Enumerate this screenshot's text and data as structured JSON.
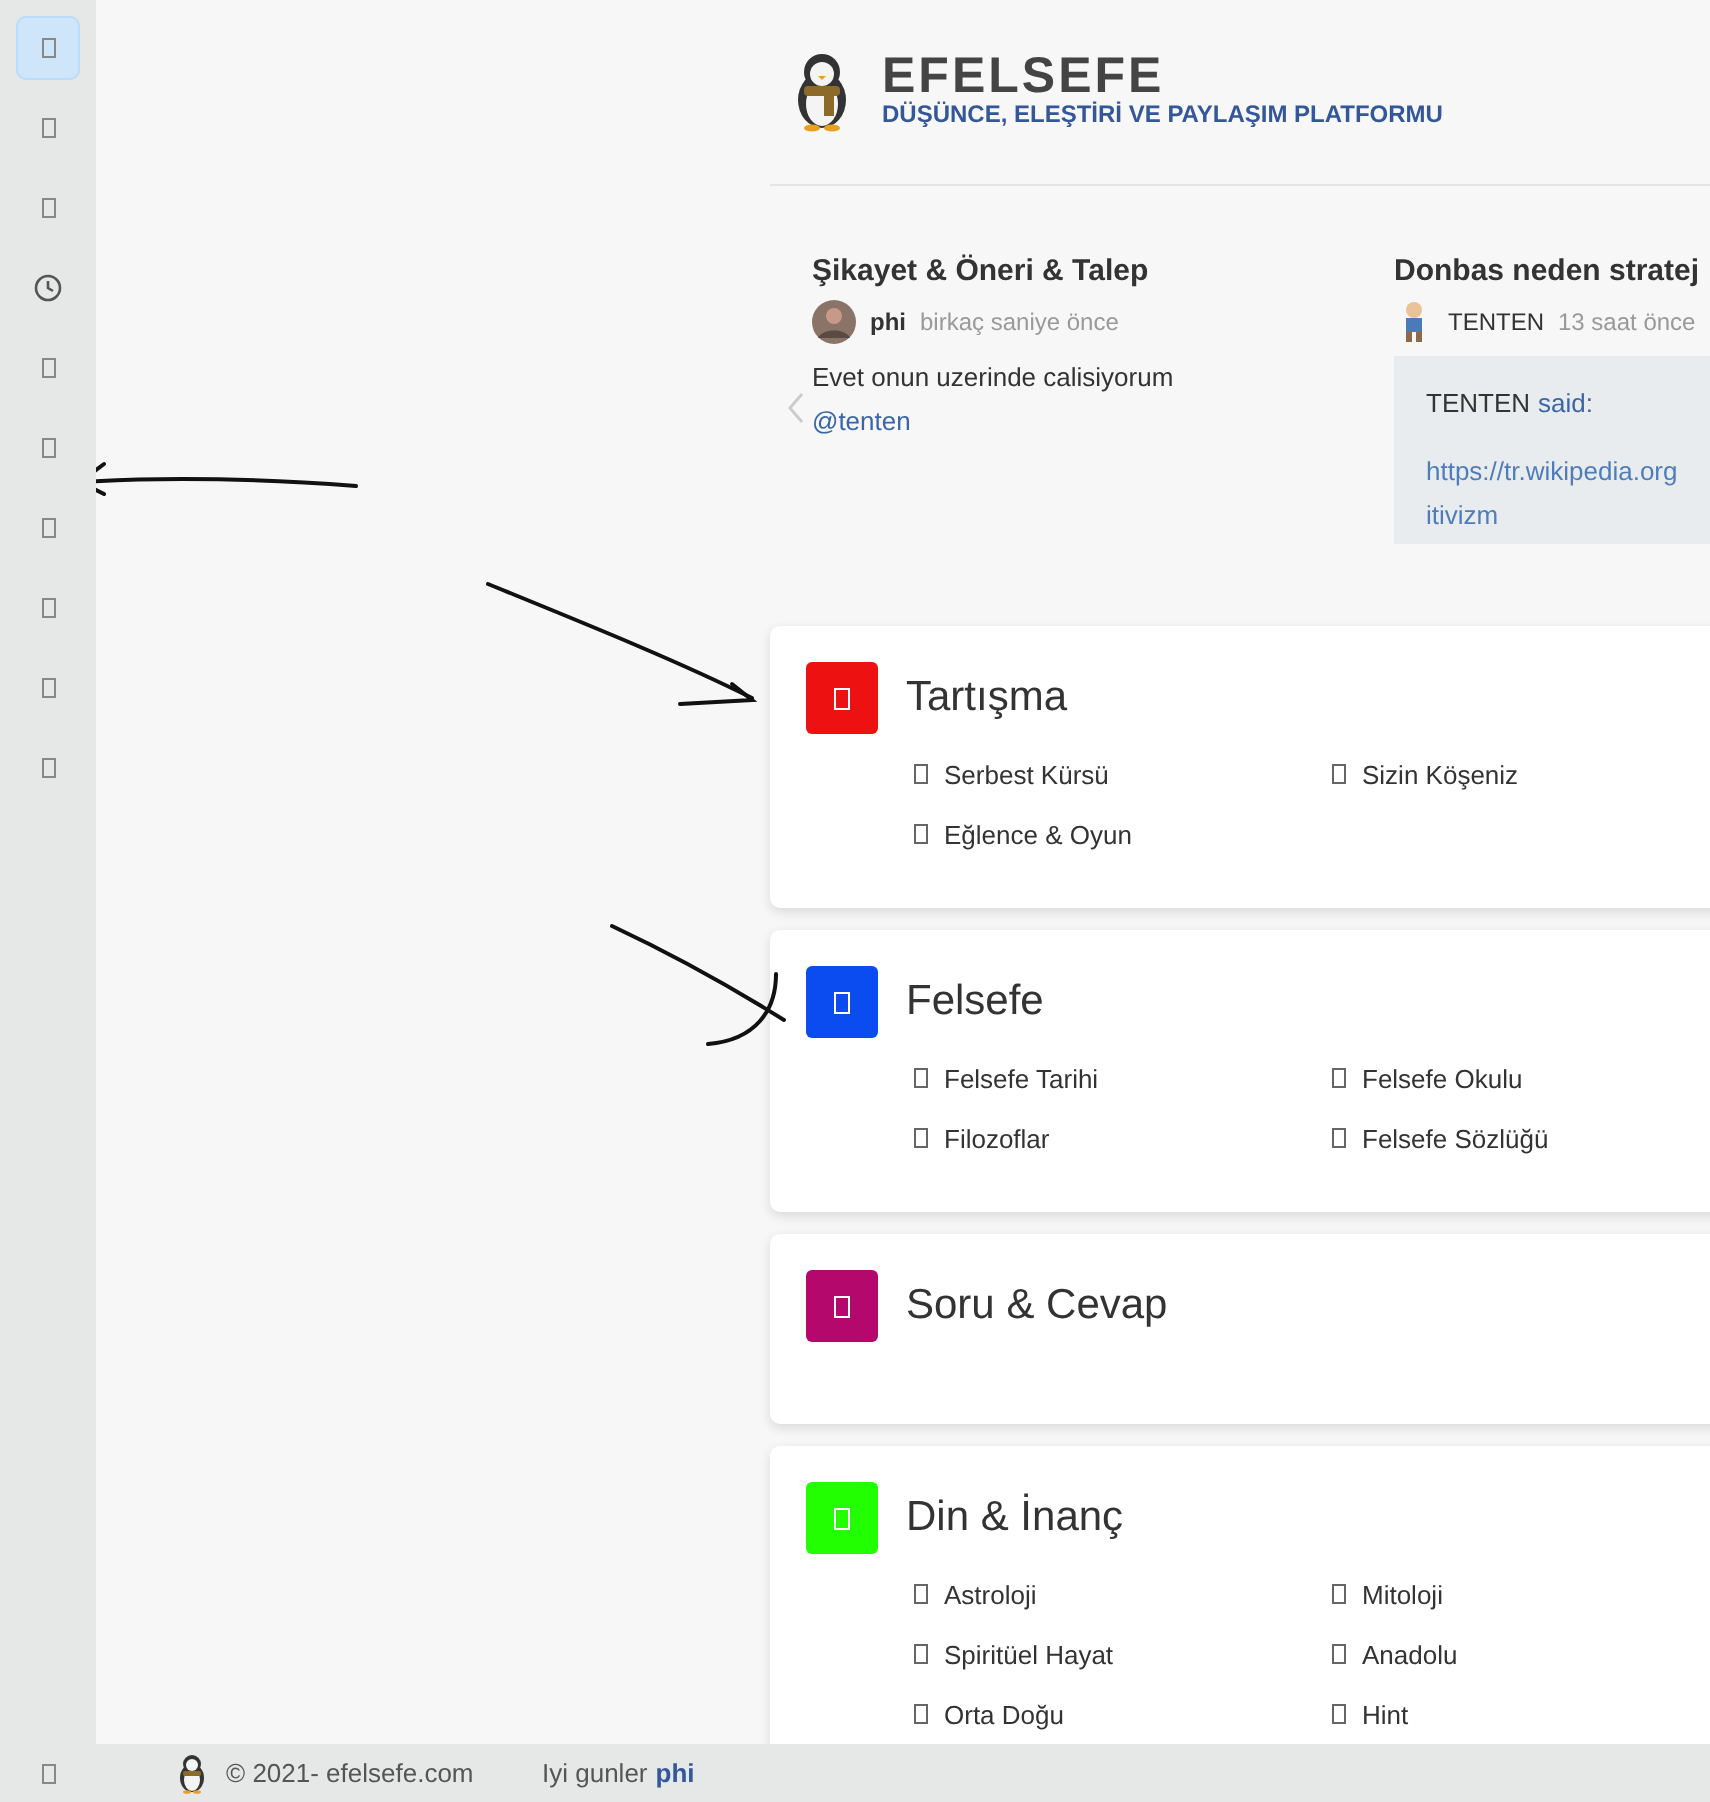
{
  "sidebar": {
    "items": [
      {
        "kind": "glyph",
        "selected": true
      },
      {
        "kind": "glyph",
        "selected": false
      },
      {
        "kind": "glyph",
        "selected": false
      },
      {
        "kind": "clock",
        "selected": false
      },
      {
        "kind": "glyph",
        "selected": false
      },
      {
        "kind": "glyph",
        "selected": false
      },
      {
        "kind": "glyph",
        "selected": false
      },
      {
        "kind": "glyph",
        "selected": false
      },
      {
        "kind": "glyph",
        "selected": false
      },
      {
        "kind": "glyph",
        "selected": false
      }
    ],
    "bottom_item": {
      "kind": "glyph",
      "selected": false
    }
  },
  "header": {
    "title": "EFELSEFE",
    "subtitle": "DÜŞÜNCE, ELEŞTİRİ VE PAYLAŞIM PLATFORMU"
  },
  "recent_posts": [
    {
      "kind": "reply",
      "title": "Şikayet & Öneri & Talep",
      "author": "phi",
      "time": "birkaç saniye önce",
      "body": "Evet onun uzerinde calisiyorum",
      "mention": "@tenten"
    },
    {
      "kind": "quote",
      "title": "Donbas neden stratej",
      "author": "TENTEN",
      "time": "13 saat önce",
      "quote": {
        "author": "TENTEN",
        "said": "said:",
        "link_lines": [
          "https://tr.wikipedia.org",
          "itivizm"
        ]
      }
    }
  ],
  "categories": [
    {
      "title": "Tartışma",
      "color": "#ee1111",
      "forums": [
        "Serbest Kürsü",
        "Sizin Köşeniz",
        "Eğlence & Oyun"
      ]
    },
    {
      "title": "Felsefe",
      "color": "#0b4cf0",
      "forums": [
        "Felsefe Tarihi",
        "Felsefe Okulu",
        "Filozoflar",
        "Felsefe Sözlüğü"
      ]
    },
    {
      "title": "Soru & Cevap",
      "color": "#b4086c"
    },
    {
      "title": "Din & İnanç",
      "color": "#22ff00",
      "forums": [
        "Astroloji",
        "Mitoloji",
        "Spiritüel Hayat",
        "Anadolu",
        "Orta Doğu",
        "Hint"
      ]
    }
  ],
  "footer": {
    "copyright": "© 2021- efelsefe.com",
    "greeting": "Iyi gunler",
    "user": "phi"
  }
}
